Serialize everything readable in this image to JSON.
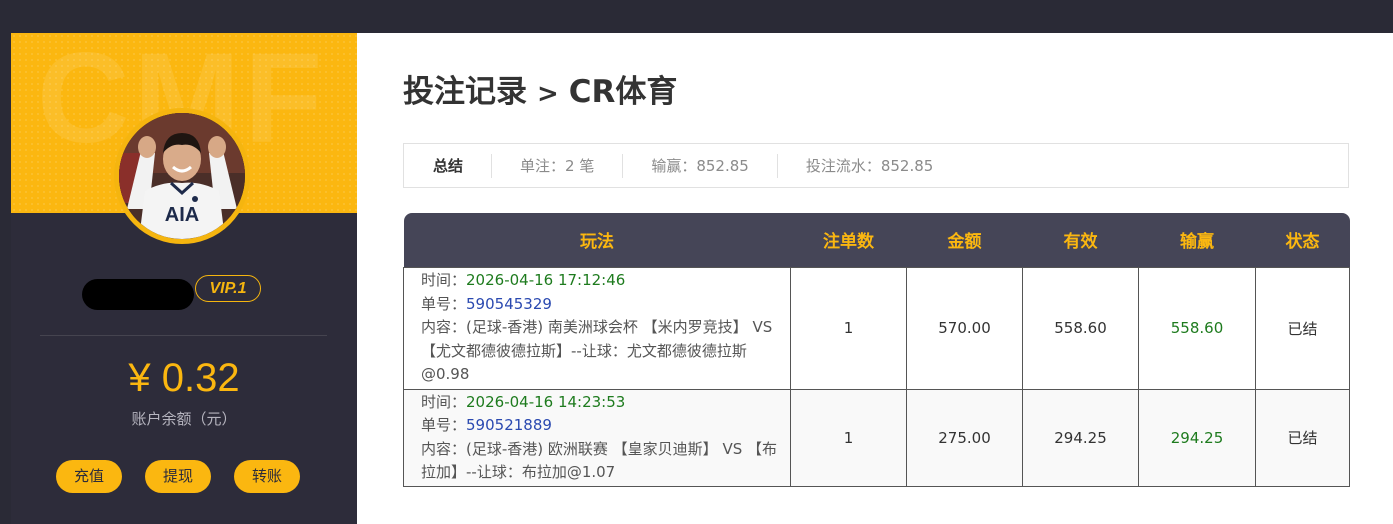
{
  "sidebar": {
    "banner_watermark": "CMF",
    "vip_label": "VIP.1",
    "balance": "¥ 0.32",
    "balance_label": "账户余额（元）",
    "buttons": {
      "deposit": "充值",
      "withdraw": "提现",
      "transfer": "转账"
    }
  },
  "header": {
    "title": "投注记录",
    "separator": ">",
    "subtitle": "CR体育"
  },
  "summary": {
    "title": "总结",
    "bets": "单注：2 笔",
    "win_loss": "输赢：852.85",
    "turnover": "投注流水：852.85"
  },
  "table": {
    "headers": [
      "玩法",
      "注单数",
      "金额",
      "有效",
      "输赢",
      "状态"
    ],
    "rows": [
      {
        "time_label": "时间：",
        "time": "2026-04-16 17:12:46",
        "order_label": "单号：",
        "order": "590545329",
        "content_label": "内容：",
        "content": "(足球-香港) 南美洲球会杯 【米内罗竞技】 VS 【尤文都德彼德拉斯】--让球：尤文都德彼德拉斯@0.98",
        "count": "1",
        "amount": "570.00",
        "valid": "558.60",
        "win_loss": "558.60",
        "status": "已结"
      },
      {
        "time_label": "时间：",
        "time": "2026-04-16 14:23:53",
        "order_label": "单号：",
        "order": "590521889",
        "content_label": "内容：",
        "content": "(足球-香港) 欧洲联赛 【皇家贝迪斯】 VS 【布拉加】--让球：布拉加@1.07",
        "count": "1",
        "amount": "275.00",
        "valid": "294.25",
        "win_loss": "294.25",
        "status": "已结"
      }
    ]
  },
  "colors": {
    "accent": "#fbb710",
    "sidebar_bg": "#2d2c3a",
    "table_header_bg": "#454557",
    "positive": "#1e7b1e",
    "link": "#2a49b0"
  },
  "avatar": {
    "shirt_text": "AIA"
  }
}
